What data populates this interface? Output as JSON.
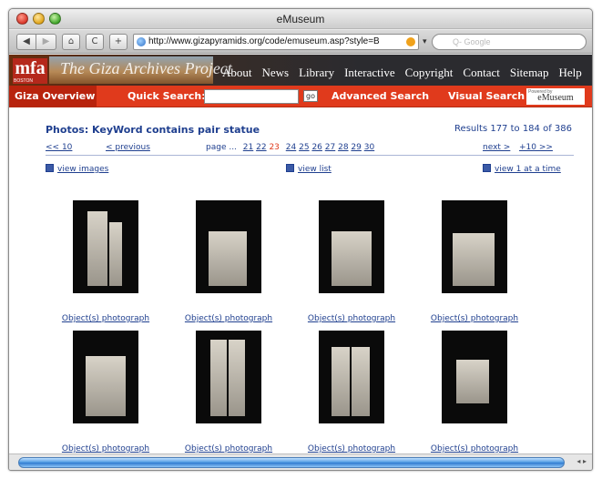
{
  "window": {
    "title": "eMuseum"
  },
  "toolbar": {
    "back": "◀",
    "forward": "▶",
    "home": "⌂",
    "reload": "C",
    "add": "+",
    "url": "http://www.gizapyramids.org/code/emuseum.asp?style=B",
    "search_placeholder": "Q- Google"
  },
  "site": {
    "logo": "mfa",
    "logo_sub": "BOSTON",
    "banner_title": "The Giza Archives Project",
    "nav": [
      "About",
      "News",
      "Library",
      "Interactive",
      "Copyright",
      "Contact",
      "Sitemap",
      "Help"
    ],
    "giza_overview": "Giza Overview",
    "quick_search_label": "Quick Search:",
    "go_label": "go",
    "advanced_search": "Advanced Search",
    "visual_search": "Visual Search",
    "powered_by": "Powered by",
    "emuseum_badge": "eMuseum"
  },
  "results": {
    "title": "Photos: KeyWord contains pair statue",
    "count": "Results 177 to 184 of 386"
  },
  "pagination": {
    "back10": "<< 10",
    "previous": "< previous",
    "page_label": "page ...",
    "pages": [
      "21",
      "22",
      "23",
      "24",
      "25",
      "26",
      "27",
      "28",
      "29",
      "30"
    ],
    "current_page": "23",
    "next": "next >",
    "fwd10": "+10 >>"
  },
  "views": {
    "images": "view images",
    "list": "view list",
    "one_at_a_time": "view 1 at a time"
  },
  "photos": [
    {
      "caption": "Object(s) photograph"
    },
    {
      "caption": "Object(s) photograph"
    },
    {
      "caption": "Object(s) photograph"
    },
    {
      "caption": "Object(s) photograph"
    },
    {
      "caption": "Object(s) photograph"
    },
    {
      "caption": "Object(s) photograph"
    },
    {
      "caption": "Object(s) photograph"
    },
    {
      "caption": "Object(s) photograph"
    }
  ],
  "colors": {
    "nav_red": "#e03a1c",
    "link_blue": "#1f3f8f",
    "current_page": "#e03a1c"
  }
}
